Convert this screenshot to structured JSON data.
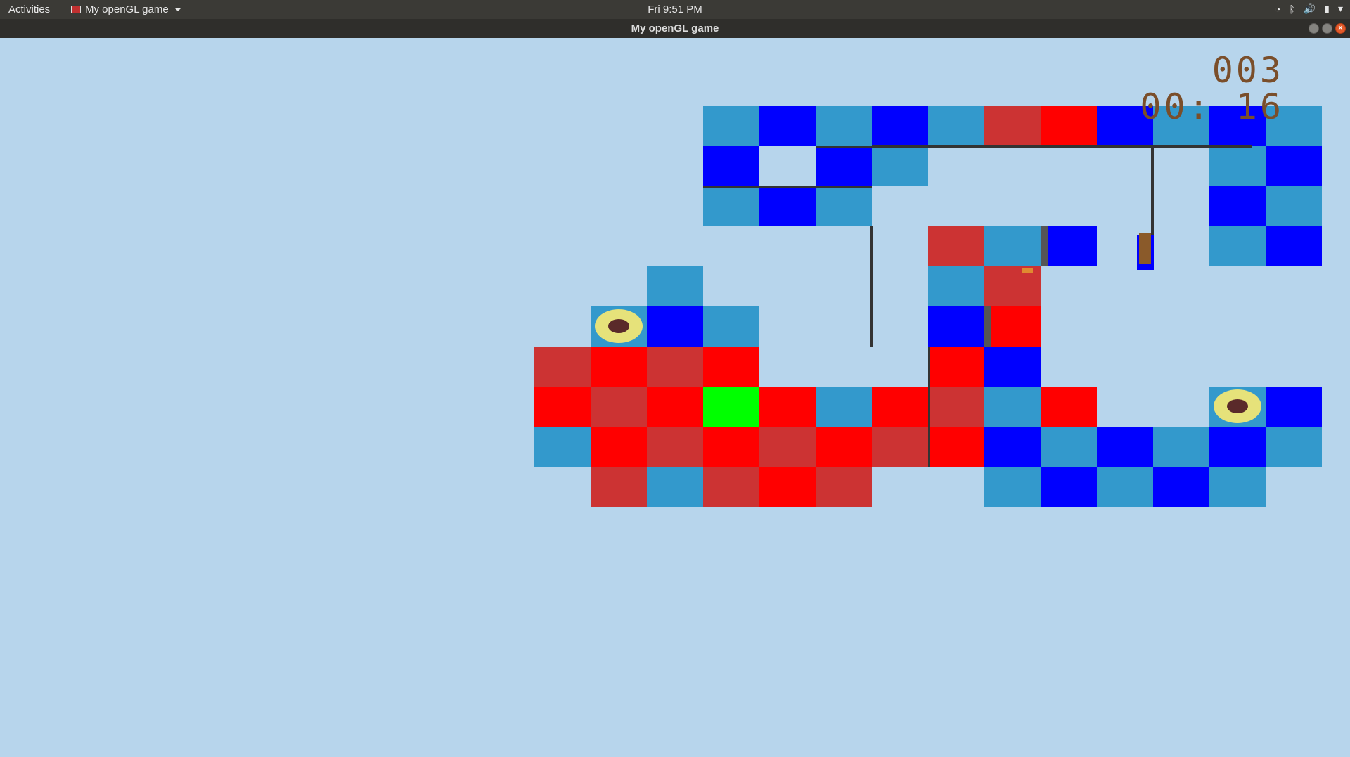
{
  "system_bar": {
    "activities": "Activities",
    "app_name": "My openGL game",
    "clock": "Fri  9:51 PM",
    "tray_icons": [
      "wifi-icon",
      "bluetooth-icon",
      "volume-icon",
      "battery-icon",
      "chevron-down-icon"
    ]
  },
  "window": {
    "title": "My openGL game",
    "buttons": [
      "minimize-icon",
      "maximize-icon",
      "close-icon"
    ]
  },
  "hud": {
    "moves": "003",
    "time": "00: 16"
  },
  "colors": {
    "background": "#b7d5ec",
    "light_blue": "#3399cc",
    "blue": "#0000ff",
    "red": "#ff0000",
    "dark_red": "#cc3333",
    "green": "#00ff00",
    "goal_ring": "#e6e27a",
    "goal_hole": "#5a2a2a",
    "hud_text": "#7a4e2a"
  }
}
